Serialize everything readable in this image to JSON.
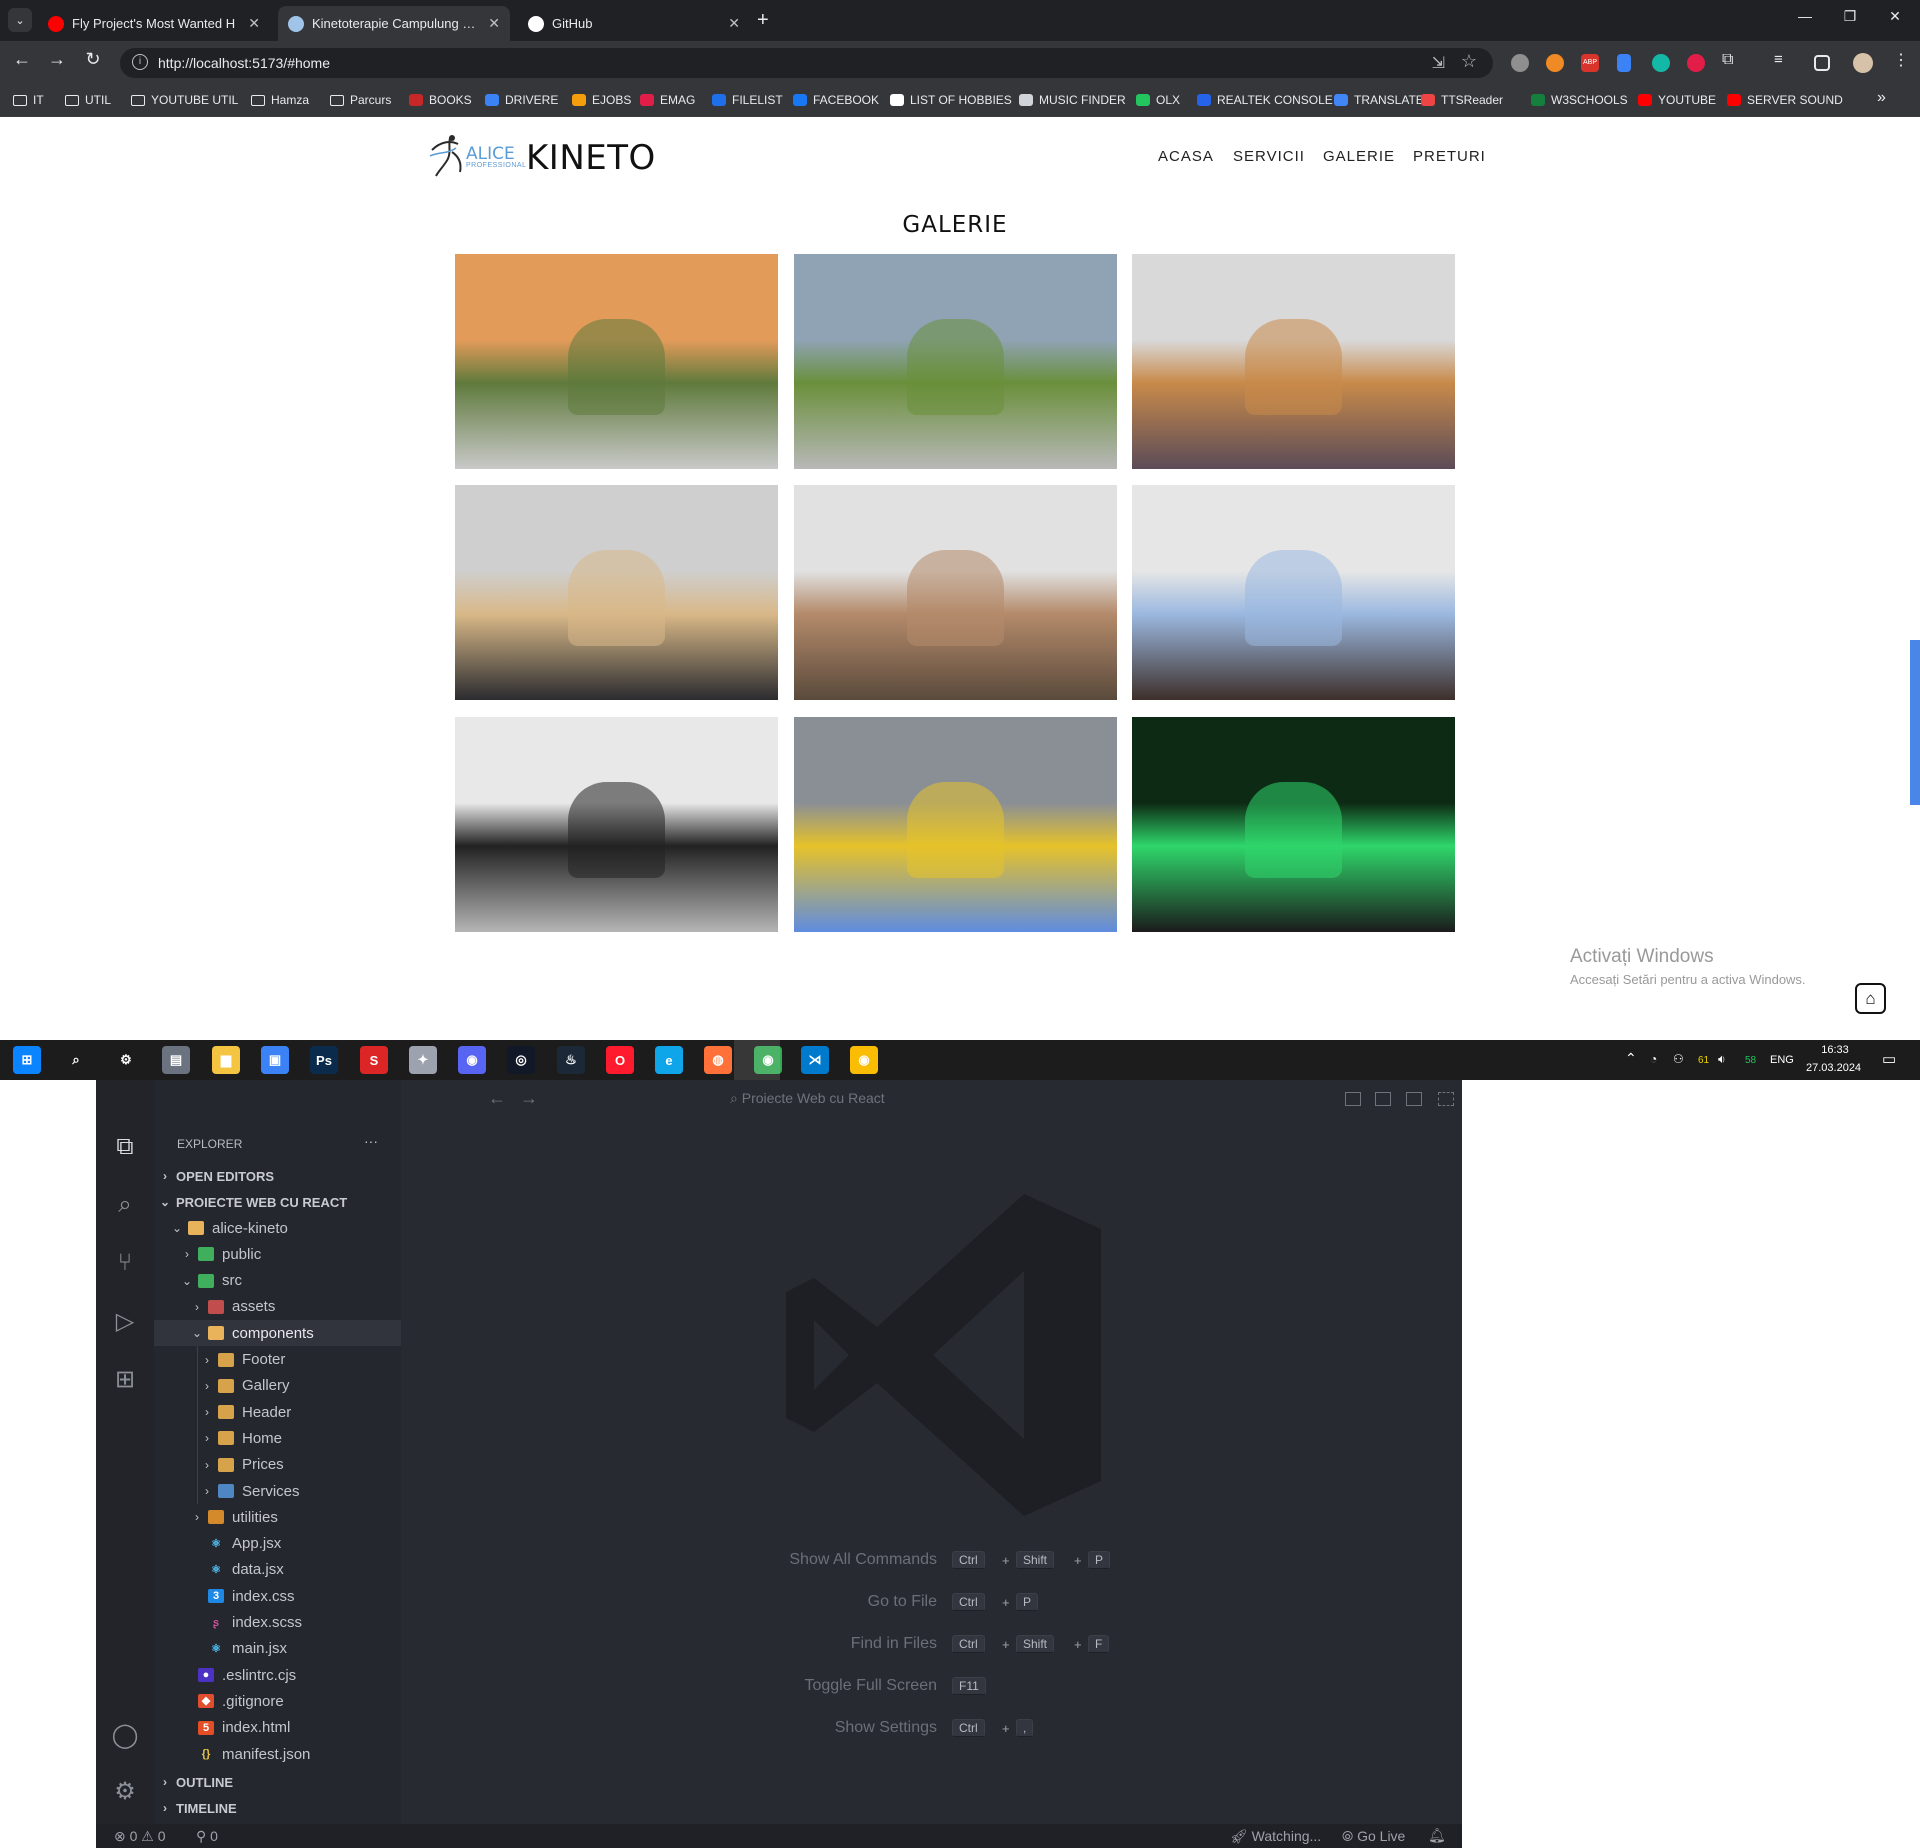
{
  "browser": {
    "tabs": [
      {
        "title": "Fly Project's Most Wanted H",
        "active": false,
        "favicon_color": "#ff0000"
      },
      {
        "title": "Kinetoterapie Campulung Musc",
        "active": true,
        "favicon_color": "#a0c4e8"
      },
      {
        "title": "GitHub",
        "active": false,
        "favicon_color": "#ffffff"
      }
    ],
    "url": "http://localhost:5173/#home",
    "bookmarks": [
      "IT",
      "UTIL",
      "YOUTUBE UTIL",
      "Hamza",
      "Parcurs",
      "BOOKS",
      "DRIVERE",
      "EJOBS",
      "EMAG",
      "FILELIST",
      "FACEBOOK",
      "LIST OF HOBBIES",
      "MUSIC FINDER",
      "OLX",
      "REALTEK CONSOLE",
      "TRANSLATE",
      "TTSReader",
      "W3SCHOOLS",
      "YOUTUBE",
      "SERVER SOUND"
    ],
    "more_bookmarks": "»"
  },
  "site": {
    "logo_small": "ALICE",
    "logo_sub": "PROFESSIONAL",
    "logo_main": "KINETO",
    "nav": [
      "ACASA",
      "SERVICII",
      "GALERIE",
      "PRETURI"
    ],
    "gallery_title": "GALERIE",
    "photos": [
      {
        "label": "exterior-fence-car",
        "colors": [
          "#e39b5a",
          "#5f7a3c",
          "#c9c9c9"
        ]
      },
      {
        "label": "window-plants-chair",
        "colors": [
          "#8fa3b4",
          "#6a8f3b",
          "#b8b8b8"
        ]
      },
      {
        "label": "room-massage-table",
        "colors": [
          "#d9d9d9",
          "#c88a4a",
          "#5b4b58"
        ]
      },
      {
        "label": "room-corner-lamp",
        "colors": [
          "#cfcfcf",
          "#d8b888",
          "#2b2b2f"
        ]
      },
      {
        "label": "room-wall-bars",
        "colors": [
          "#e1e1e1",
          "#b48a6a",
          "#5a4a3c"
        ]
      },
      {
        "label": "room-mirror-bike",
        "colors": [
          "#e6e6e6",
          "#9bb8e0",
          "#3d2f2a"
        ]
      },
      {
        "label": "treadmill",
        "colors": [
          "#e8e8e8",
          "#222222",
          "#b5b5b5"
        ]
      },
      {
        "label": "flower-pots-diffuser",
        "colors": [
          "#8a8f96",
          "#e6c22a",
          "#5f8ce0"
        ]
      },
      {
        "label": "green-diffuser",
        "colors": [
          "#0d2a14",
          "#2fd66b",
          "#1b1b1b"
        ]
      }
    ],
    "windows_activation_title": "Activați Windows",
    "windows_activation_sub": "Accesați Setări pentru a activa Windows.",
    "home_icon": "home-icon"
  },
  "taskbar": {
    "time": "16:33",
    "date": "27.03.2024",
    "lang": "ENG",
    "tray_values": [
      "61",
      "58"
    ]
  },
  "vscode": {
    "command_center": "Proiecte Web cu React",
    "explorer_title": "EXPLORER",
    "explorer_more": "···",
    "sections": {
      "open_editors": "OPEN EDITORS",
      "project": "PROIECTE WEB CU REACT",
      "outline": "OUTLINE",
      "timeline": "TIMELINE"
    },
    "tree": [
      {
        "label": "alice-kineto",
        "depth": 1,
        "type": "folder-open",
        "chev": "⌄"
      },
      {
        "label": "public",
        "depth": 2,
        "type": "folder-green",
        "chev": "›"
      },
      {
        "label": "src",
        "depth": 2,
        "type": "folder-green",
        "chev": "⌄"
      },
      {
        "label": "assets",
        "depth": 3,
        "type": "folder-assets",
        "chev": "›"
      },
      {
        "label": "components",
        "depth": 3,
        "type": "folder-open",
        "chev": "⌄",
        "selected": true
      },
      {
        "label": "Footer",
        "depth": 4,
        "type": "folder",
        "chev": "›"
      },
      {
        "label": "Gallery",
        "depth": 4,
        "type": "folder",
        "chev": "›"
      },
      {
        "label": "Header",
        "depth": 4,
        "type": "folder",
        "chev": "›"
      },
      {
        "label": "Home",
        "depth": 4,
        "type": "folder",
        "chev": "›"
      },
      {
        "label": "Prices",
        "depth": 4,
        "type": "folder",
        "chev": "›"
      },
      {
        "label": "Services",
        "depth": 4,
        "type": "folder-blue",
        "chev": "›"
      },
      {
        "label": "utilities",
        "depth": 3,
        "type": "folder-util",
        "chev": "›"
      },
      {
        "label": "App.jsx",
        "depth": 3,
        "type": "react",
        "chev": ""
      },
      {
        "label": "data.jsx",
        "depth": 3,
        "type": "react",
        "chev": ""
      },
      {
        "label": "index.css",
        "depth": 3,
        "type": "css",
        "chev": ""
      },
      {
        "label": "index.scss",
        "depth": 3,
        "type": "scss",
        "chev": ""
      },
      {
        "label": "main.jsx",
        "depth": 3,
        "type": "react",
        "chev": ""
      },
      {
        "label": ".eslintrc.cjs",
        "depth": 2,
        "type": "eslint",
        "chev": ""
      },
      {
        "label": ".gitignore",
        "depth": 2,
        "type": "git",
        "chev": ""
      },
      {
        "label": "index.html",
        "depth": 2,
        "type": "html",
        "chev": ""
      },
      {
        "label": "manifest.json",
        "depth": 2,
        "type": "json",
        "chev": ""
      }
    ],
    "shortcuts": [
      {
        "label": "Show All Commands",
        "keys": [
          "Ctrl",
          "Shift",
          "P"
        ]
      },
      {
        "label": "Go to File",
        "keys": [
          "Ctrl",
          "P"
        ]
      },
      {
        "label": "Find in Files",
        "keys": [
          "Ctrl",
          "Shift",
          "F"
        ]
      },
      {
        "label": "Toggle Full Screen",
        "keys": [
          "F11"
        ]
      },
      {
        "label": "Show Settings",
        "keys": [
          "Ctrl",
          ","
        ]
      }
    ],
    "status": {
      "errors": "0",
      "warnings": "0",
      "ports": "0",
      "watching": "Watching...",
      "golive": "Go Live"
    }
  }
}
